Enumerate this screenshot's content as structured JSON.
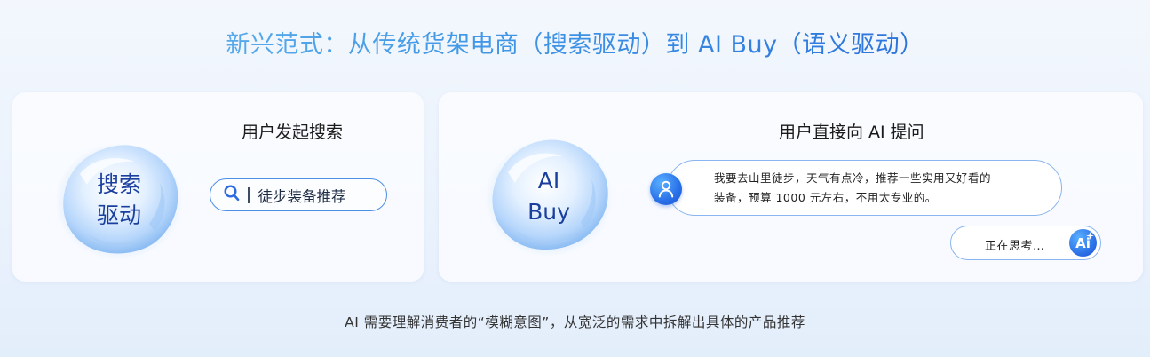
{
  "title": "新兴范式：从传统货架电商（搜索驱动）到 AI Buy（语义驱动）",
  "left_card": {
    "orb_line1": "搜索",
    "orb_line2": "驱动",
    "heading": "用户发起搜索",
    "search_query": "徒步装备推荐",
    "icon": "search-icon"
  },
  "right_card": {
    "orb_line1": "AI",
    "orb_line2": "Buy",
    "heading": "用户直接向 AI 提问",
    "user_message_line1": "我要去山里徒步，天气有点冷，推荐一些实用又好看的",
    "user_message_line2": "装备，预算 1000 元左右，不用太专业的。",
    "thinking_text": "正在思考…",
    "ai_badge": "Ai",
    "icons": [
      "user-icon",
      "ai-sparkle-icon"
    ]
  },
  "footer": "AI 需要理解消费者的“模糊意图”，从宽泛的需求中拆解出具体的产品推荐",
  "colors": {
    "title_gradient_start": "#69b9ee",
    "title_gradient_end": "#1f5fd8",
    "accent_blue": "#2a6fe6",
    "orb_text": "#1b3f9e"
  }
}
